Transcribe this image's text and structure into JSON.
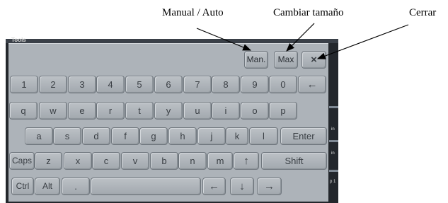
{
  "annotations": {
    "manual_auto": "Manual / Auto",
    "resize": "Cambiar tamaño",
    "close": "Cerrar"
  },
  "background": {
    "title": "Tools",
    "right_labels": [
      "in",
      "in",
      "p 1"
    ]
  },
  "keyboard": {
    "top": {
      "manual": "Man.",
      "max": "Max",
      "close": "×"
    },
    "row1": [
      "1",
      "2",
      "3",
      "4",
      "5",
      "6",
      "7",
      "8",
      "9",
      "0",
      "←"
    ],
    "row2": [
      "q",
      "w",
      "e",
      "r",
      "t",
      "y",
      "u",
      "i",
      "o",
      "p"
    ],
    "row3": [
      "a",
      "s",
      "d",
      "f",
      "g",
      "h",
      "j",
      "k",
      "l",
      "Enter"
    ],
    "row4": [
      "Caps",
      "z",
      "x",
      "c",
      "v",
      "b",
      "n",
      "m",
      "↑",
      "Shift"
    ],
    "row5": [
      "Ctrl",
      "Alt",
      ".",
      "",
      "←",
      "↓",
      "→"
    ]
  },
  "colors": {
    "keyboard_bg": "#adb3b9",
    "key_face": "#b5bac0",
    "background_window": "#23272c"
  }
}
